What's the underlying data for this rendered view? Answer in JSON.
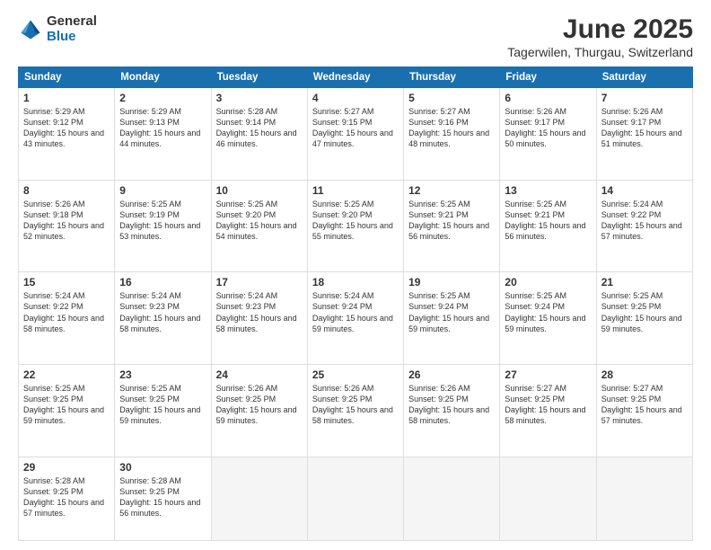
{
  "logo": {
    "general": "General",
    "blue": "Blue"
  },
  "header": {
    "month": "June 2025",
    "location": "Tagerwilen, Thurgau, Switzerland"
  },
  "weekdays": [
    "Sunday",
    "Monday",
    "Tuesday",
    "Wednesday",
    "Thursday",
    "Friday",
    "Saturday"
  ],
  "weeks": [
    [
      {
        "day": "1",
        "sunrise": "5:29 AM",
        "sunset": "9:12 PM",
        "daylight": "15 hours and 43 minutes."
      },
      {
        "day": "2",
        "sunrise": "5:29 AM",
        "sunset": "9:13 PM",
        "daylight": "15 hours and 44 minutes."
      },
      {
        "day": "3",
        "sunrise": "5:28 AM",
        "sunset": "9:14 PM",
        "daylight": "15 hours and 46 minutes."
      },
      {
        "day": "4",
        "sunrise": "5:27 AM",
        "sunset": "9:15 PM",
        "daylight": "15 hours and 47 minutes."
      },
      {
        "day": "5",
        "sunrise": "5:27 AM",
        "sunset": "9:16 PM",
        "daylight": "15 hours and 48 minutes."
      },
      {
        "day": "6",
        "sunrise": "5:26 AM",
        "sunset": "9:17 PM",
        "daylight": "15 hours and 50 minutes."
      },
      {
        "day": "7",
        "sunrise": "5:26 AM",
        "sunset": "9:17 PM",
        "daylight": "15 hours and 51 minutes."
      }
    ],
    [
      {
        "day": "8",
        "sunrise": "5:26 AM",
        "sunset": "9:18 PM",
        "daylight": "15 hours and 52 minutes."
      },
      {
        "day": "9",
        "sunrise": "5:25 AM",
        "sunset": "9:19 PM",
        "daylight": "15 hours and 53 minutes."
      },
      {
        "day": "10",
        "sunrise": "5:25 AM",
        "sunset": "9:20 PM",
        "daylight": "15 hours and 54 minutes."
      },
      {
        "day": "11",
        "sunrise": "5:25 AM",
        "sunset": "9:20 PM",
        "daylight": "15 hours and 55 minutes."
      },
      {
        "day": "12",
        "sunrise": "5:25 AM",
        "sunset": "9:21 PM",
        "daylight": "15 hours and 56 minutes."
      },
      {
        "day": "13",
        "sunrise": "5:25 AM",
        "sunset": "9:21 PM",
        "daylight": "15 hours and 56 minutes."
      },
      {
        "day": "14",
        "sunrise": "5:24 AM",
        "sunset": "9:22 PM",
        "daylight": "15 hours and 57 minutes."
      }
    ],
    [
      {
        "day": "15",
        "sunrise": "5:24 AM",
        "sunset": "9:22 PM",
        "daylight": "15 hours and 58 minutes."
      },
      {
        "day": "16",
        "sunrise": "5:24 AM",
        "sunset": "9:23 PM",
        "daylight": "15 hours and 58 minutes."
      },
      {
        "day": "17",
        "sunrise": "5:24 AM",
        "sunset": "9:23 PM",
        "daylight": "15 hours and 58 minutes."
      },
      {
        "day": "18",
        "sunrise": "5:24 AM",
        "sunset": "9:24 PM",
        "daylight": "15 hours and 59 minutes."
      },
      {
        "day": "19",
        "sunrise": "5:25 AM",
        "sunset": "9:24 PM",
        "daylight": "15 hours and 59 minutes."
      },
      {
        "day": "20",
        "sunrise": "5:25 AM",
        "sunset": "9:24 PM",
        "daylight": "15 hours and 59 minutes."
      },
      {
        "day": "21",
        "sunrise": "5:25 AM",
        "sunset": "9:25 PM",
        "daylight": "15 hours and 59 minutes."
      }
    ],
    [
      {
        "day": "22",
        "sunrise": "5:25 AM",
        "sunset": "9:25 PM",
        "daylight": "15 hours and 59 minutes."
      },
      {
        "day": "23",
        "sunrise": "5:25 AM",
        "sunset": "9:25 PM",
        "daylight": "15 hours and 59 minutes."
      },
      {
        "day": "24",
        "sunrise": "5:26 AM",
        "sunset": "9:25 PM",
        "daylight": "15 hours and 59 minutes."
      },
      {
        "day": "25",
        "sunrise": "5:26 AM",
        "sunset": "9:25 PM",
        "daylight": "15 hours and 58 minutes."
      },
      {
        "day": "26",
        "sunrise": "5:26 AM",
        "sunset": "9:25 PM",
        "daylight": "15 hours and 58 minutes."
      },
      {
        "day": "27",
        "sunrise": "5:27 AM",
        "sunset": "9:25 PM",
        "daylight": "15 hours and 58 minutes."
      },
      {
        "day": "28",
        "sunrise": "5:27 AM",
        "sunset": "9:25 PM",
        "daylight": "15 hours and 57 minutes."
      }
    ],
    [
      {
        "day": "29",
        "sunrise": "5:28 AM",
        "sunset": "9:25 PM",
        "daylight": "15 hours and 57 minutes."
      },
      {
        "day": "30",
        "sunrise": "5:28 AM",
        "sunset": "9:25 PM",
        "daylight": "15 hours and 56 minutes."
      },
      null,
      null,
      null,
      null,
      null
    ]
  ]
}
